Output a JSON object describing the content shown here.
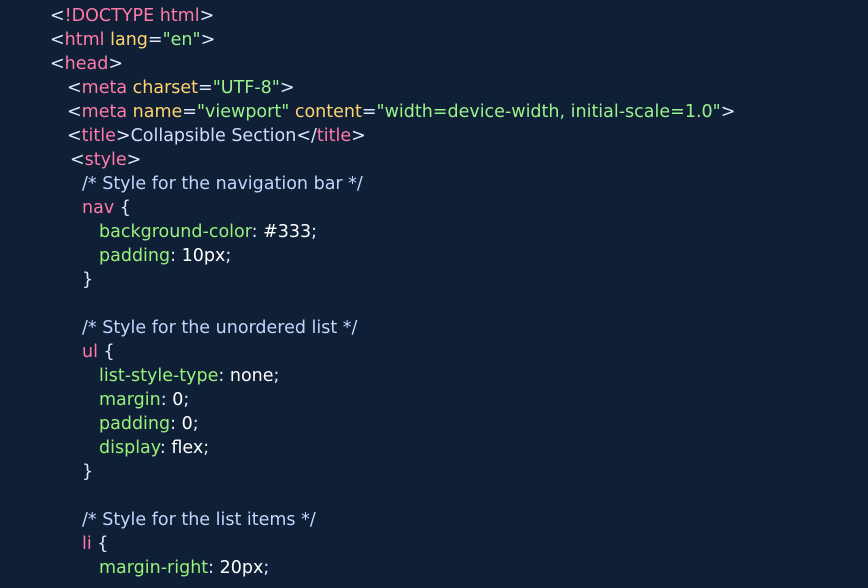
{
  "lines": [
    {
      "id": "l1",
      "parts": [
        {
          "t": "<",
          "c": "punc"
        },
        {
          "t": "!DOCTYPE",
          "c": "doctype"
        },
        {
          "t": " ",
          "c": "punc"
        },
        {
          "t": "html",
          "c": "tag"
        },
        {
          "t": ">",
          "c": "punc"
        }
      ]
    },
    {
      "id": "l2",
      "parts": [
        {
          "t": "<",
          "c": "punc"
        },
        {
          "t": "html",
          "c": "tag"
        },
        {
          "t": " ",
          "c": "punc"
        },
        {
          "t": "lang",
          "c": "attr"
        },
        {
          "t": "=",
          "c": "punc"
        },
        {
          "t": "\"en\"",
          "c": "str"
        },
        {
          "t": ">",
          "c": "punc"
        }
      ]
    },
    {
      "id": "l3",
      "parts": [
        {
          "t": "<",
          "c": "punc"
        },
        {
          "t": "head",
          "c": "tag"
        },
        {
          "t": ">",
          "c": "punc"
        }
      ]
    },
    {
      "id": "l4",
      "parts": [
        {
          "t": "<",
          "c": "punc"
        },
        {
          "t": "meta",
          "c": "tag"
        },
        {
          "t": " ",
          "c": "punc"
        },
        {
          "t": "charset",
          "c": "attr"
        },
        {
          "t": "=",
          "c": "punc"
        },
        {
          "t": "\"UTF-8\"",
          "c": "str"
        },
        {
          "t": ">",
          "c": "punc"
        }
      ]
    },
    {
      "id": "l5",
      "parts": [
        {
          "t": "<",
          "c": "punc"
        },
        {
          "t": "meta",
          "c": "tag"
        },
        {
          "t": " ",
          "c": "punc"
        },
        {
          "t": "name",
          "c": "attr"
        },
        {
          "t": "=",
          "c": "punc"
        },
        {
          "t": "\"viewport\"",
          "c": "str"
        },
        {
          "t": " ",
          "c": "punc"
        },
        {
          "t": "content",
          "c": "attr"
        },
        {
          "t": "=",
          "c": "punc"
        },
        {
          "t": "\"width=device-width, initial-scale=1.0\"",
          "c": "str"
        },
        {
          "t": ">",
          "c": "punc"
        }
      ]
    },
    {
      "id": "l6",
      "parts": [
        {
          "t": "<",
          "c": "punc"
        },
        {
          "t": "title",
          "c": "tag"
        },
        {
          "t": ">",
          "c": "punc"
        },
        {
          "t": "Collapsible Section",
          "c": "txt"
        },
        {
          "t": "</",
          "c": "punc"
        },
        {
          "t": "title",
          "c": "tag"
        },
        {
          "t": ">",
          "c": "punc"
        }
      ]
    },
    {
      "id": "l7",
      "parts": [
        {
          "t": "<",
          "c": "punc"
        },
        {
          "t": "style",
          "c": "tag"
        },
        {
          "t": ">",
          "c": "punc"
        }
      ]
    },
    {
      "id": "l8",
      "parts": [
        {
          "t": "/* Style for the navigation bar */",
          "c": "comment"
        }
      ]
    },
    {
      "id": "l9",
      "parts": [
        {
          "t": "nav",
          "c": "sel"
        },
        {
          "t": " {",
          "c": "punc"
        }
      ]
    },
    {
      "id": "l10",
      "parts": [
        {
          "t": "background-color",
          "c": "prop"
        },
        {
          "t": ": ",
          "c": "punc"
        },
        {
          "t": "#333",
          "c": "val"
        },
        {
          "t": ";",
          "c": "punc"
        }
      ]
    },
    {
      "id": "l11",
      "parts": [
        {
          "t": "padding",
          "c": "prop"
        },
        {
          "t": ": ",
          "c": "punc"
        },
        {
          "t": "10px",
          "c": "val"
        },
        {
          "t": ";",
          "c": "punc"
        }
      ]
    },
    {
      "id": "l12",
      "parts": [
        {
          "t": "}",
          "c": "punc"
        }
      ]
    },
    {
      "id": "l13",
      "parts": []
    },
    {
      "id": "l14",
      "parts": [
        {
          "t": "/* Style for the unordered list */",
          "c": "comment"
        }
      ]
    },
    {
      "id": "l15",
      "parts": [
        {
          "t": "ul",
          "c": "sel"
        },
        {
          "t": " {",
          "c": "punc"
        }
      ]
    },
    {
      "id": "l16",
      "parts": [
        {
          "t": "list-style-type",
          "c": "prop"
        },
        {
          "t": ": ",
          "c": "punc"
        },
        {
          "t": "none",
          "c": "val"
        },
        {
          "t": ";",
          "c": "punc"
        }
      ]
    },
    {
      "id": "l17",
      "parts": [
        {
          "t": "margin",
          "c": "prop"
        },
        {
          "t": ": ",
          "c": "punc"
        },
        {
          "t": "0",
          "c": "val"
        },
        {
          "t": ";",
          "c": "punc"
        }
      ]
    },
    {
      "id": "l18",
      "parts": [
        {
          "t": "padding",
          "c": "prop"
        },
        {
          "t": ": ",
          "c": "punc"
        },
        {
          "t": "0",
          "c": "val"
        },
        {
          "t": ";",
          "c": "punc"
        }
      ]
    },
    {
      "id": "l19",
      "parts": [
        {
          "t": "display",
          "c": "prop"
        },
        {
          "t": ": ",
          "c": "punc"
        },
        {
          "t": "flex",
          "c": "val"
        },
        {
          "t": ";",
          "c": "punc"
        }
      ]
    },
    {
      "id": "l20",
      "parts": [
        {
          "t": "}",
          "c": "punc"
        }
      ]
    },
    {
      "id": "l21",
      "parts": []
    },
    {
      "id": "l22",
      "parts": [
        {
          "t": "/* Style for the list items */",
          "c": "comment"
        }
      ]
    },
    {
      "id": "l23",
      "parts": [
        {
          "t": "li",
          "c": "sel"
        },
        {
          "t": " {",
          "c": "punc"
        }
      ]
    },
    {
      "id": "l24",
      "parts": [
        {
          "t": "margin-right",
          "c": "prop"
        },
        {
          "t": ": ",
          "c": "punc"
        },
        {
          "t": "20px",
          "c": "val"
        },
        {
          "t": ";",
          "c": "punc"
        }
      ]
    }
  ]
}
